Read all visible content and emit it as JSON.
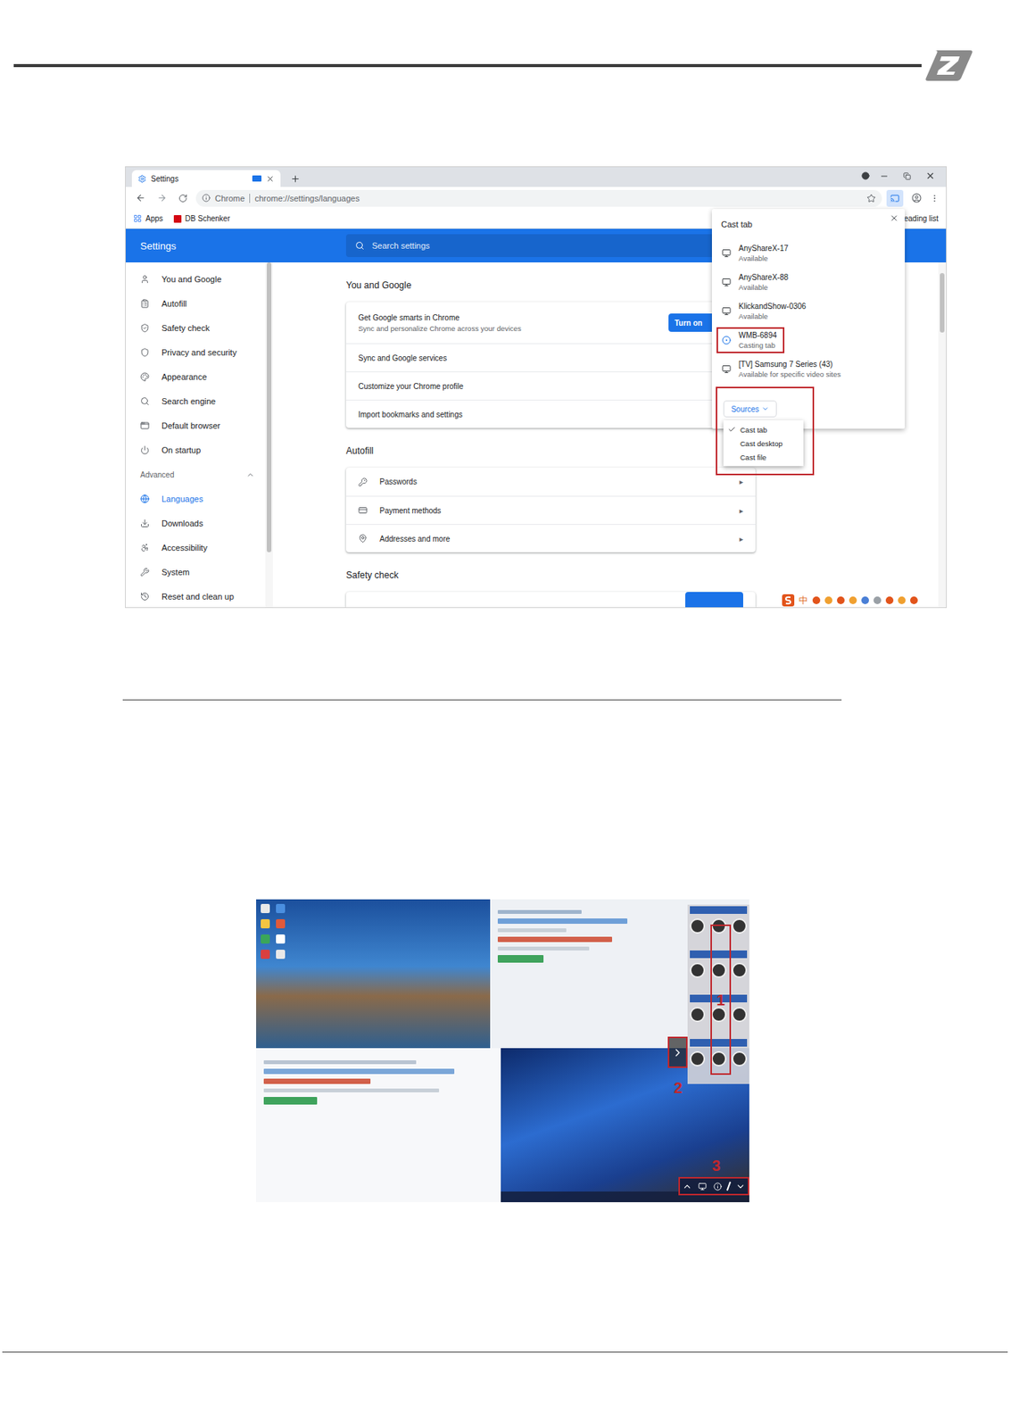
{
  "browser": {
    "tabs": [
      {
        "label": "Settings",
        "selected": true
      }
    ],
    "address": {
      "chip": "Chrome",
      "url": "chrome://settings/languages"
    },
    "bookmarks": [
      "Apps",
      "DB Schenker"
    ],
    "reading_list": "eading list",
    "cast_active": true
  },
  "settings": {
    "title": "Settings",
    "search_placeholder": "Search settings",
    "sidebar": {
      "items": [
        {
          "label": "You and Google",
          "selected": false
        },
        {
          "label": "Autofill",
          "selected": false
        },
        {
          "label": "Safety check",
          "selected": false
        },
        {
          "label": "Privacy and security",
          "selected": false
        },
        {
          "label": "Appearance",
          "selected": false
        },
        {
          "label": "Search engine",
          "selected": false
        },
        {
          "label": "Default browser",
          "selected": false
        },
        {
          "label": "On startup",
          "selected": false
        }
      ],
      "advanced": {
        "label": "Advanced",
        "expanded": true
      },
      "advanced_items": [
        {
          "label": "Languages",
          "selected": true
        },
        {
          "label": "Downloads",
          "selected": false
        },
        {
          "label": "Accessibility",
          "selected": false
        },
        {
          "label": "System",
          "selected": false
        },
        {
          "label": "Reset and clean up",
          "selected": false
        }
      ]
    },
    "sections": [
      {
        "title": "You and Google",
        "rows": [
          {
            "label": "Get Google smarts in Chrome",
            "sub": "Sync and personalize Chrome across your devices",
            "button": "Turn on"
          },
          {
            "label": "Sync and Google services"
          },
          {
            "label": "Customize your Chrome profile"
          },
          {
            "label": "Import bookmarks and settings"
          }
        ]
      },
      {
        "title": "Autofill",
        "rows": [
          {
            "label": "Passwords",
            "arrow": "▸"
          },
          {
            "label": "Payment methods",
            "arrow": "▸"
          },
          {
            "label": "Addresses and more",
            "arrow": "▸"
          }
        ]
      },
      {
        "title": "Safety check",
        "rows": []
      }
    ]
  },
  "cast": {
    "title": "Cast tab",
    "devices": [
      {
        "name": "AnyShareX-17",
        "status": "Available",
        "selected": false,
        "annotated": false
      },
      {
        "name": "AnyShareX-88",
        "status": "Available",
        "selected": false,
        "annotated": false
      },
      {
        "name": "KlickandShow-0306",
        "status": "Available",
        "selected": false,
        "annotated": false
      },
      {
        "name": "WMB-6894",
        "status": "Casting tab",
        "selected": true,
        "annotated": true
      },
      {
        "name": "[TV] Samsung 7 Series (43)",
        "status": "Available for specific video sites",
        "selected": false,
        "annotated": false
      }
    ],
    "sources": {
      "label": "Sources"
    },
    "source_menu": [
      {
        "label": "Cast tab",
        "checked": true
      },
      {
        "label": "Cast desktop",
        "checked": false
      },
      {
        "label": "Cast file",
        "checked": false
      }
    ]
  },
  "ime": {
    "label": "中"
  },
  "demo": {
    "annotations": [
      {
        "label": "1"
      },
      {
        "label": "2"
      },
      {
        "label": "3"
      }
    ]
  }
}
